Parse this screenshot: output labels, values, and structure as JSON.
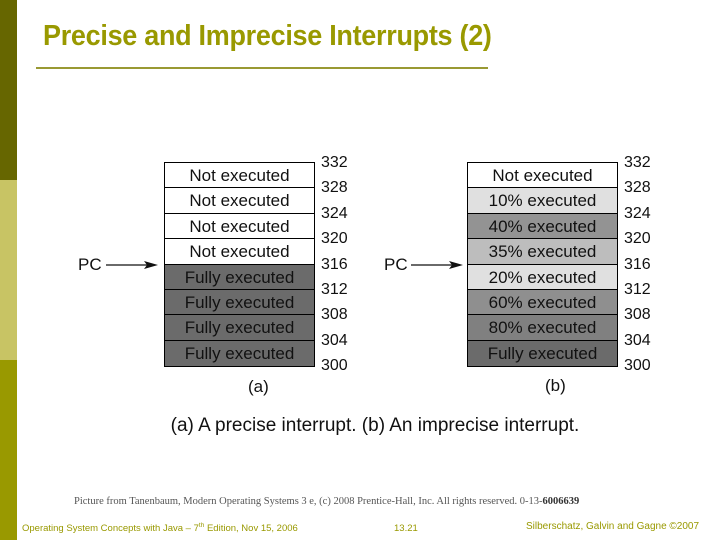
{
  "slide": {
    "title": "Precise and Imprecise Interrupts (2)",
    "accent_color": "#999900",
    "sidebar_colors": [
      "#666600",
      "#c8c464",
      "#999900"
    ]
  },
  "diagram_a": {
    "label": "(a)",
    "pc_label": "PC",
    "pc_points_to_address": 316,
    "cells": [
      {
        "text": "Not executed",
        "shade": "#ffffff"
      },
      {
        "text": "Not executed",
        "shade": "#ffffff"
      },
      {
        "text": "Not executed",
        "shade": "#ffffff"
      },
      {
        "text": "Not executed",
        "shade": "#ffffff"
      },
      {
        "text": "Fully executed",
        "shade": "#6b6b6b"
      },
      {
        "text": "Fully executed",
        "shade": "#6b6b6b"
      },
      {
        "text": "Fully executed",
        "shade": "#6b6b6b"
      },
      {
        "text": "Fully executed",
        "shade": "#6b6b6b"
      }
    ],
    "addresses": [
      "332",
      "328",
      "324",
      "320",
      "316",
      "312",
      "308",
      "304",
      "300"
    ]
  },
  "diagram_b": {
    "label": "(b)",
    "pc_label": "PC",
    "pc_points_to_address": 316,
    "cells": [
      {
        "text": "Not executed",
        "shade": "#ffffff"
      },
      {
        "text": "10% executed",
        "shade": "#e0e0e0"
      },
      {
        "text": "40% executed",
        "shade": "#939393"
      },
      {
        "text": "35% executed",
        "shade": "#bdbdbd"
      },
      {
        "text": "20% executed",
        "shade": "#e0e0e0"
      },
      {
        "text": "60% executed",
        "shade": "#8f8f8f"
      },
      {
        "text": "80% executed",
        "shade": "#808080"
      },
      {
        "text": "Fully executed",
        "shade": "#6b6b6b"
      }
    ],
    "addresses": [
      "332",
      "328",
      "324",
      "320",
      "316",
      "312",
      "308",
      "304",
      "300"
    ]
  },
  "caption": "(a) A precise interrupt. (b) An imprecise interrupt.",
  "credit": {
    "text": "Picture from Tanenbaum, Modern Operating Systems 3 e, (c) 2008 Prentice-Hall, Inc. All rights reserved. 0-13-",
    "isbn_tail": "6006639"
  },
  "footer": {
    "left_prefix": "Operating System Concepts with Java – 7",
    "left_sup": "th",
    "left_suffix": " Edition, Nov 15, 2006",
    "page": "13.21",
    "right": "Silberschatz, Galvin and Gagne ©2007"
  }
}
